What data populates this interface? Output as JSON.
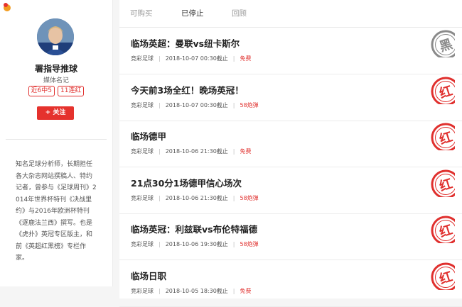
{
  "profile": {
    "name": "署指导推球",
    "title": "媒体名记",
    "badges": [
      "近6中5",
      "11连红"
    ],
    "follow_label": "+ 关注",
    "bio": "知名足球分析师，长期担任各大杂志网站撰稿人、特约记者，曾参与《足球周刊》2014年世界杯特刊《决战里约》与2016年欧洲杯特刊《逐鹿法兰西》撰写。也是《虎扑》英冠专区版主，和前《英超红黑榜》专栏作家。"
  },
  "tabs": [
    {
      "label": "可购买",
      "active": false
    },
    {
      "label": "已停止",
      "active": true
    },
    {
      "label": "回顾",
      "active": false
    }
  ],
  "items": [
    {
      "title": "临场英超：曼联vs纽卡斯尔",
      "category": "竞彩足球",
      "deadline": "2018-10-07 00:30截止",
      "price": "免费",
      "stamp": "黑",
      "stamp_color": "#8a8a8a"
    },
    {
      "title": "今天前3场全红！晚场英冠！",
      "category": "竞彩足球",
      "deadline": "2018-10-07 00:30截止",
      "price": "58炮弹",
      "stamp": "红",
      "stamp_color": "#e0302e"
    },
    {
      "title": "临场德甲",
      "category": "竞彩足球",
      "deadline": "2018-10-06 21:30截止",
      "price": "免费",
      "stamp": "红",
      "stamp_color": "#e0302e"
    },
    {
      "title": "21点30分1场德甲信心场次",
      "category": "竞彩足球",
      "deadline": "2018-10-06 21:30截止",
      "price": "58炮弹",
      "stamp": "红",
      "stamp_color": "#e0302e"
    },
    {
      "title": "临场英冠：利兹联vs布伦特福德",
      "category": "竞彩足球",
      "deadline": "2018-10-06 19:30截止",
      "price": "58炮弹",
      "stamp": "红",
      "stamp_color": "#e0302e"
    },
    {
      "title": "临场日职",
      "category": "竞彩足球",
      "deadline": "2018-10-05 18:30截止",
      "price": "免费",
      "stamp": "红",
      "stamp_color": "#e0302e"
    }
  ]
}
